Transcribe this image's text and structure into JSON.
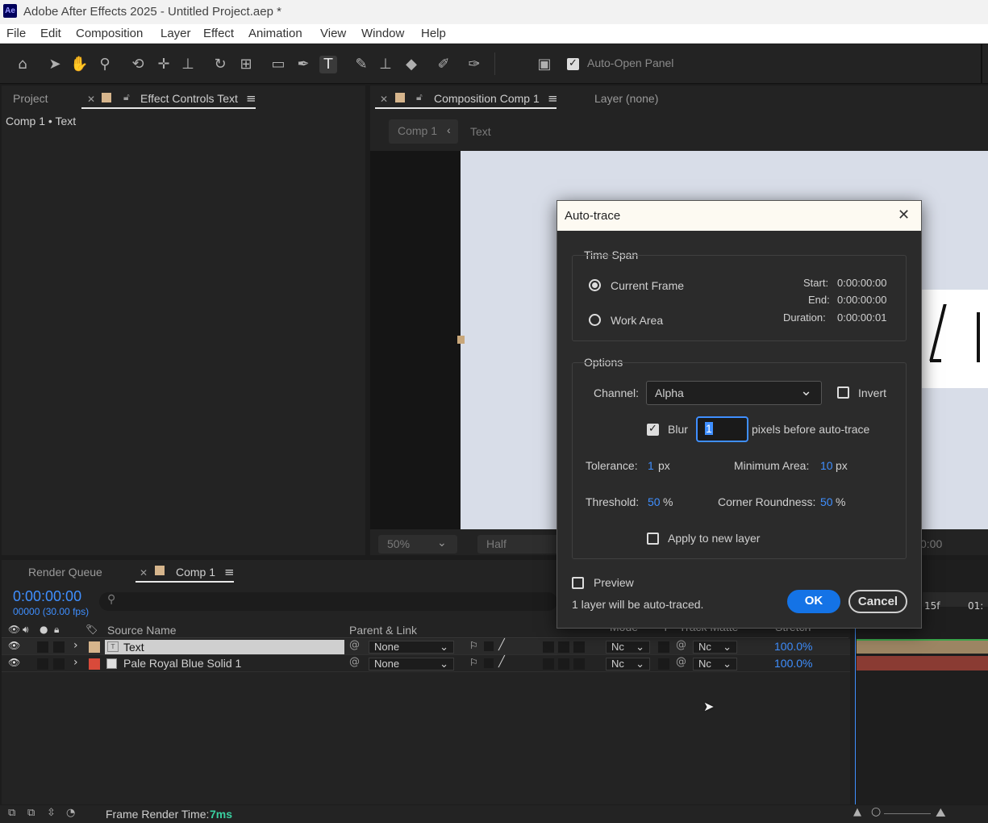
{
  "app": {
    "logo": "Ae",
    "title": "Adobe After Effects 2025 - Untitled Project.aep *"
  },
  "menu": [
    "File",
    "Edit",
    "Composition",
    "Layer",
    "Effect",
    "Animation",
    "View",
    "Window",
    "Help"
  ],
  "toolbar": {
    "auto_open_label": "Auto-Open Panel",
    "tools": [
      "home-icon",
      "selection-tool-icon",
      "hand-tool-icon",
      "zoom-tool-icon",
      "orbit-camera-icon",
      "pan-camera-icon",
      "dolly-camera-icon",
      "rotate-tool-icon",
      "pan-behind-icon",
      "rectangle-tool-icon",
      "pen-tool-icon",
      "type-tool-icon",
      "brush-tool-icon",
      "clone-stamp-icon",
      "eraser-icon",
      "roto-brush-icon",
      "puppet-pin-icon"
    ]
  },
  "left_panel": {
    "tab_project": "Project",
    "tab_effect_controls": "Effect Controls Text",
    "breadcrumb": "Comp 1 • Text"
  },
  "comp_panel": {
    "tab_composition": "Composition Comp 1",
    "tab_layer": "Layer (none)",
    "crumb_comp": "Comp 1",
    "crumb_layer": "Text",
    "zoom": "50%",
    "resolution": "Half",
    "timecode_partial": "0:00"
  },
  "timeline": {
    "tab_render": "Render Queue",
    "tab_comp": "Comp 1",
    "timecode": "0:00:00:00",
    "frames": "00000 (30.00 fps)",
    "col_source": "Source Name",
    "col_parent": "Parent & Link",
    "col_mode": "Mode",
    "col_t": "T",
    "col_track": "Track Matte",
    "col_stretch": "Stretch",
    "ruler_15f": "15f",
    "ruler_01": "01:",
    "layers": [
      {
        "name": "Text",
        "label_color": "#d6b58c",
        "parent": "None",
        "mode": "Nc",
        "matte": "Nc",
        "stretch": "100.0%"
      },
      {
        "name": "Pale Royal Blue Solid 1",
        "label_color": "#d94a3a",
        "parent": "None",
        "mode": "Nc",
        "matte": "Nc",
        "stretch": "100.0%"
      }
    ],
    "render_time_label": "Frame Render Time:",
    "render_time_value": "7ms"
  },
  "dialog": {
    "title": "Auto-trace",
    "time_span_label": "Time Span",
    "current_frame": "Current Frame",
    "work_area": "Work Area",
    "start_label": "Start:",
    "start_value": "0:00:00:00",
    "end_label": "End:",
    "end_value": "0:00:00:00",
    "duration_label": "Duration:",
    "duration_value": "0:00:00:01",
    "options_label": "Options",
    "channel_label": "Channel:",
    "channel_value": "Alpha",
    "invert_label": "Invert",
    "blur_label": "Blur",
    "blur_value": "1",
    "blur_suffix": "pixels before auto-trace",
    "tolerance_label": "Tolerance:",
    "tolerance_value": "1",
    "tolerance_unit": "px",
    "min_area_label": "Minimum Area:",
    "min_area_value": "10",
    "min_area_unit": "px",
    "threshold_label": "Threshold:",
    "threshold_value": "50",
    "threshold_unit": "%",
    "corner_label": "Corner Roundness:",
    "corner_value": "50",
    "corner_unit": "%",
    "apply_new_layer": "Apply to new layer",
    "preview_label": "Preview",
    "status": "1 layer will be auto-traced.",
    "ok_label": "OK",
    "cancel_label": "Cancel"
  }
}
